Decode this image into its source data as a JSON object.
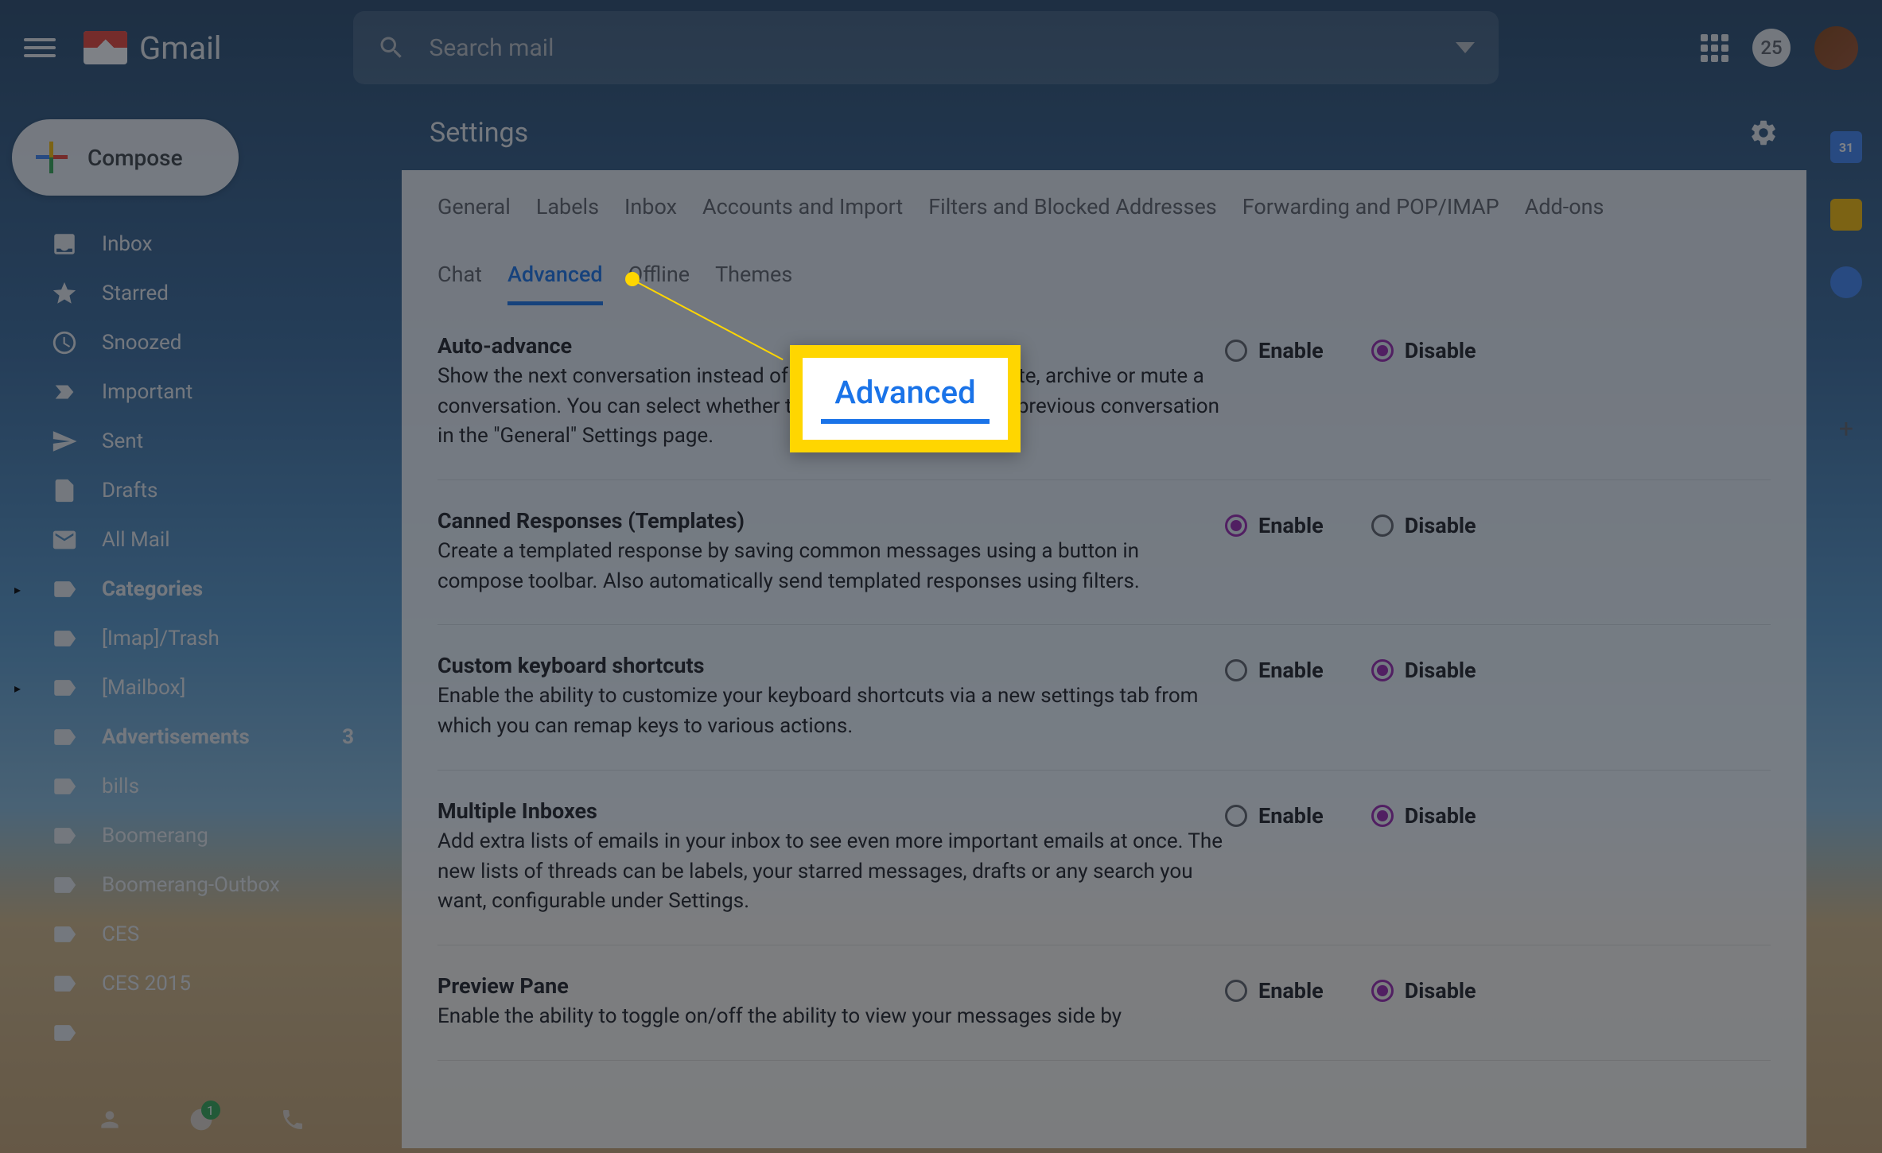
{
  "header": {
    "app_name": "Gmail",
    "search_placeholder": "Search mail",
    "notification_count": "25"
  },
  "compose": {
    "label": "Compose"
  },
  "sidebar": {
    "items": [
      {
        "label": "Inbox",
        "icon": "inbox"
      },
      {
        "label": "Starred",
        "icon": "star"
      },
      {
        "label": "Snoozed",
        "icon": "clock"
      },
      {
        "label": "Important",
        "icon": "important"
      },
      {
        "label": "Sent",
        "icon": "sent"
      },
      {
        "label": "Drafts",
        "icon": "draft"
      },
      {
        "label": "All Mail",
        "icon": "mail"
      },
      {
        "label": "Categories",
        "icon": "label",
        "bold": true,
        "expandable": true
      },
      {
        "label": "[Imap]/Trash",
        "icon": "label"
      },
      {
        "label": "[Mailbox]",
        "icon": "label",
        "expandable": true
      },
      {
        "label": "Advertisements",
        "icon": "label",
        "bold": true,
        "count": "3"
      },
      {
        "label": "bills",
        "icon": "label"
      },
      {
        "label": "Boomerang",
        "icon": "label"
      },
      {
        "label": "Boomerang-Outbox",
        "icon": "label"
      },
      {
        "label": "CES",
        "icon": "label"
      },
      {
        "label": "CES 2015",
        "icon": "label"
      },
      {
        "label": "",
        "icon": "label"
      }
    ]
  },
  "settings": {
    "title": "Settings",
    "tabs_row1": [
      "General",
      "Labels",
      "Inbox",
      "Accounts and Import",
      "Filters and Blocked Addresses",
      "Forwarding and POP/IMAP",
      "Add-ons"
    ],
    "tabs_row2": [
      "Chat",
      "Advanced",
      "Offline",
      "Themes"
    ],
    "active_tab": "Advanced",
    "enable_label": "Enable",
    "disable_label": "Disable",
    "items": [
      {
        "title": "Auto-advance",
        "desc": "Show the next conversation instead of your inbox after you delete, archive or mute a conversation. You can select whether to advance to the next or previous conversation in the \"General\" Settings page.",
        "selected": "disable"
      },
      {
        "title": "Canned Responses (Templates)",
        "desc": "Create a templated response by saving common messages using a button in compose toolbar. Also automatically send templated responses using filters.",
        "selected": "enable"
      },
      {
        "title": "Custom keyboard shortcuts",
        "desc": "Enable the ability to customize your keyboard shortcuts via a new settings tab from which you can remap keys to various actions.",
        "selected": "disable"
      },
      {
        "title": "Multiple Inboxes",
        "desc": "Add extra lists of emails in your inbox to see even more important emails at once. The new lists of threads can be labels, your starred messages, drafts or any search you want, configurable under Settings.",
        "selected": "disable"
      },
      {
        "title": "Preview Pane",
        "desc": "Enable the ability to toggle on/off the ability to view your messages side by",
        "selected": "disable"
      }
    ]
  },
  "callout": {
    "text": "Advanced"
  },
  "right_rail": {
    "calendar_day": "31"
  }
}
